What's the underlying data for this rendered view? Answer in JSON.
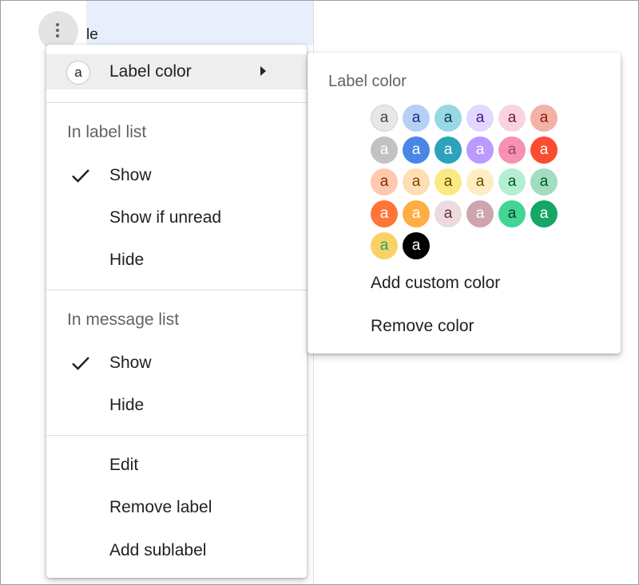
{
  "background": {
    "label_fragment": "le"
  },
  "menu": {
    "label_color": {
      "avatar_letter": "a",
      "label": "Label color"
    },
    "label_list": {
      "heading": "In label list",
      "items": [
        {
          "label": "Show",
          "checked": true
        },
        {
          "label": "Show if unread",
          "checked": false
        },
        {
          "label": "Hide",
          "checked": false
        }
      ]
    },
    "message_list": {
      "heading": "In message list",
      "items": [
        {
          "label": "Show",
          "checked": true
        },
        {
          "label": "Hide",
          "checked": false
        }
      ]
    },
    "actions": {
      "edit": "Edit",
      "remove_label": "Remove label",
      "add_sublabel": "Add sublabel"
    }
  },
  "submenu": {
    "title": "Label color",
    "swatches": [
      {
        "bg": "#e7e7e7",
        "fg": "#464646"
      },
      {
        "bg": "#b6cff5",
        "fg": "#0d3472"
      },
      {
        "bg": "#98d7e4",
        "fg": "#0d3b44"
      },
      {
        "bg": "#e3d7ff",
        "fg": "#3d188e"
      },
      {
        "bg": "#fbd3e0",
        "fg": "#711a36"
      },
      {
        "bg": "#f2b2a8",
        "fg": "#8a1c0a"
      },
      {
        "bg": "#c2c2c2",
        "fg": "#ffffff"
      },
      {
        "bg": "#4986e7",
        "fg": "#ffffff"
      },
      {
        "bg": "#2da2bb",
        "fg": "#ffffff"
      },
      {
        "bg": "#b99aff",
        "fg": "#ffffff"
      },
      {
        "bg": "#f691b2",
        "fg": "#994a64"
      },
      {
        "bg": "#fb4c2f",
        "fg": "#ffffff"
      },
      {
        "bg": "#ffc8af",
        "fg": "#7a2e0b"
      },
      {
        "bg": "#ffdeb5",
        "fg": "#7a4706"
      },
      {
        "bg": "#fbe983",
        "fg": "#594c05"
      },
      {
        "bg": "#fdedc1",
        "fg": "#684e07"
      },
      {
        "bg": "#b3efd3",
        "fg": "#0b4f30"
      },
      {
        "bg": "#a2dcc1",
        "fg": "#04502e"
      },
      {
        "bg": "#ff7537",
        "fg": "#ffffff"
      },
      {
        "bg": "#ffad46",
        "fg": "#ffffff"
      },
      {
        "bg": "#ebdbde",
        "fg": "#662e37"
      },
      {
        "bg": "#cca6ac",
        "fg": "#ffffff"
      },
      {
        "bg": "#42d692",
        "fg": "#094228"
      },
      {
        "bg": "#16a765",
        "fg": "#ffffff"
      },
      {
        "bg": "#fad165",
        "fg": "#1fa76a"
      },
      {
        "bg": "#000000",
        "fg": "#ffffff"
      }
    ],
    "swatch_letter": "a",
    "add_custom": "Add custom color",
    "remove_color": "Remove color"
  }
}
